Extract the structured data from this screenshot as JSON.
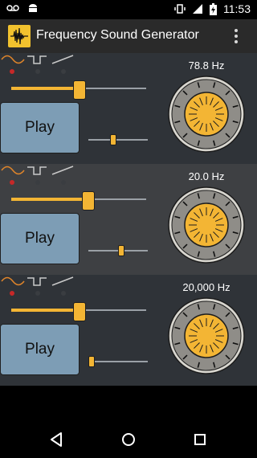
{
  "status_bar": {
    "time": "11:53",
    "left_icons": [
      "voicemail-icon",
      "android-icon"
    ],
    "right_icons": [
      "vibrate-icon",
      "signal-icon",
      "battery-charging-icon"
    ]
  },
  "app_bar": {
    "title": "Frequency Sound Generator",
    "icon": "waveform-app-icon",
    "menu_icon": "overflow-menu-icon"
  },
  "generators": [
    {
      "frequency_label": "78.8 Hz",
      "play_label": "Play",
      "selected_waveform": "sine",
      "waveform_options": [
        "sine",
        "square",
        "sawtooth"
      ],
      "coarse_slider_fraction": 0.5,
      "fine_slider_fraction": 0.4
    },
    {
      "frequency_label": "20.0 Hz",
      "play_label": "Play",
      "selected_waveform": "sine",
      "waveform_options": [
        "sine",
        "square",
        "sawtooth"
      ],
      "coarse_slider_fraction": 0.57,
      "fine_slider_fraction": 0.55
    },
    {
      "frequency_label": "20,000 Hz",
      "play_label": "Play",
      "selected_waveform": "sine",
      "waveform_options": [
        "sine",
        "square",
        "sawtooth"
      ],
      "coarse_slider_fraction": 0.5,
      "fine_slider_fraction": 0.0
    }
  ],
  "nav_bar": {
    "icons": [
      "back-icon",
      "home-icon",
      "recents-icon"
    ]
  },
  "colors": {
    "accent": "#f3b534",
    "play_button": "#7d9db5",
    "indicator_active": "#c62828",
    "panel_dark": "#2f3338",
    "panel_light": "#3e4043"
  }
}
